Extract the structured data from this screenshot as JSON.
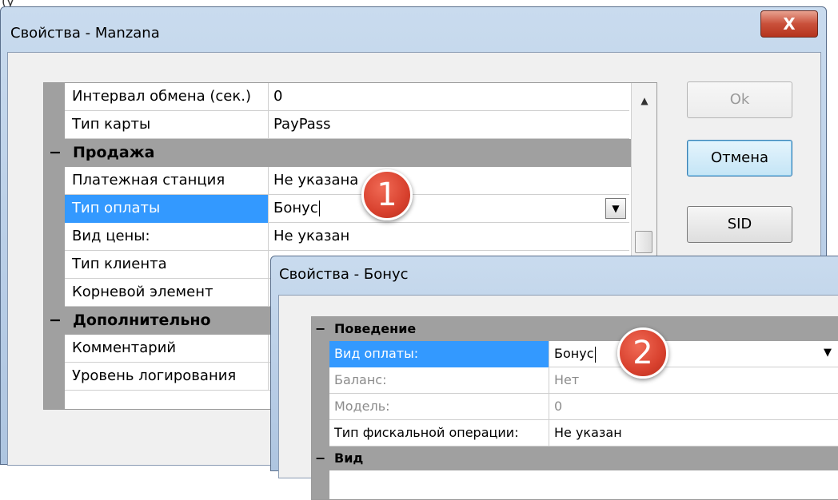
{
  "top_fragment": "(у",
  "main_window": {
    "title": "Свойства - Manzana",
    "close_label": "X",
    "grid": {
      "rows_top": [
        {
          "name": "Интервал обмена (сек.)",
          "value": "0"
        },
        {
          "name": "Тип карты",
          "value": "PayPass"
        }
      ],
      "category_sale": "Продажа",
      "rows_sale": [
        {
          "name": "Платежная станция",
          "value": "Не указана"
        },
        {
          "name": "Тип оплаты",
          "value": "Бонус"
        },
        {
          "name": "Вид цены:",
          "value": "Не указан"
        },
        {
          "name": "Тип клиента",
          "value": ""
        },
        {
          "name": "Корневой элемент",
          "value": ""
        }
      ],
      "category_extra": "Дополнительно",
      "rows_extra": [
        {
          "name": "Комментарий",
          "value": ""
        },
        {
          "name": "Уровень логирования",
          "value": ""
        }
      ],
      "expander": "−"
    },
    "buttons": {
      "ok": "Ok",
      "cancel": "Отмена",
      "sid": "SID"
    },
    "dropdown_arrow": "▼",
    "scroll_up_arrow": "▲"
  },
  "badges": {
    "first": "1",
    "second": "2"
  },
  "bonus_window": {
    "title": "Свойства - Бонус",
    "category_behavior": "Поведение",
    "rows": [
      {
        "name": "Вид оплаты:",
        "value": "Бонус"
      },
      {
        "name": "Баланс:",
        "value": "Нет"
      },
      {
        "name": "Модель:",
        "value": "0"
      },
      {
        "name": "Тип фискальной операции:",
        "value": "Не указан"
      }
    ],
    "category_view": "Вид"
  },
  "colors": {
    "selection": "#3399ff",
    "category": "#a0a0a0",
    "badge": "#d8412e"
  }
}
